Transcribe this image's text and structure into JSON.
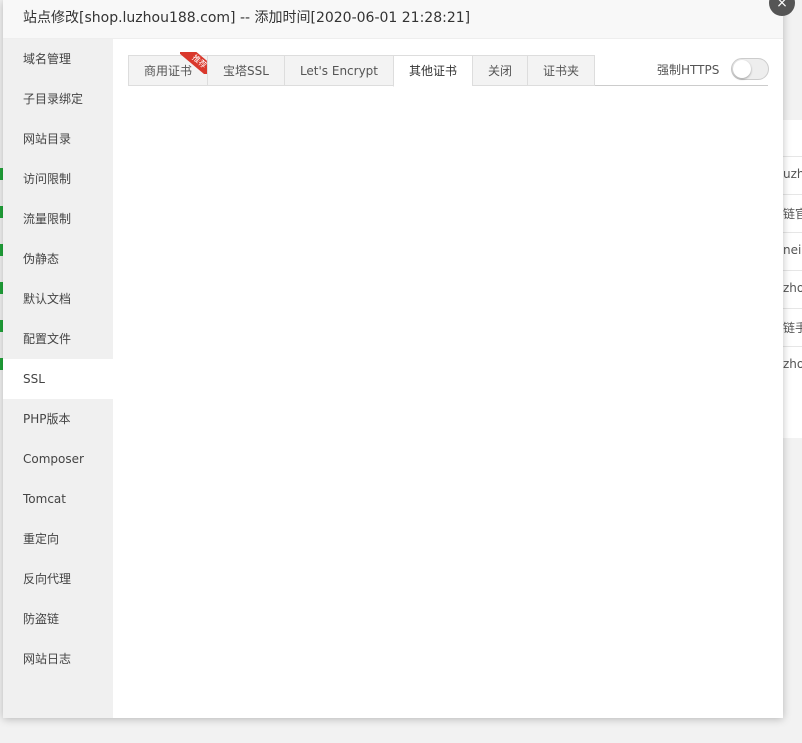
{
  "modal": {
    "title": "站点修改[shop.luzhou188.com] -- 添加时间[2020-06-01 21:28:21]",
    "close_icon": "×"
  },
  "sidebar": {
    "items": [
      {
        "label": "域名管理"
      },
      {
        "label": "子目录绑定"
      },
      {
        "label": "网站目录"
      },
      {
        "label": "访问限制"
      },
      {
        "label": "流量限制"
      },
      {
        "label": "伪静态"
      },
      {
        "label": "默认文档"
      },
      {
        "label": "配置文件"
      },
      {
        "label": "SSL"
      },
      {
        "label": "PHP版本"
      },
      {
        "label": "Composer"
      },
      {
        "label": "Tomcat"
      },
      {
        "label": "重定向"
      },
      {
        "label": "反向代理"
      },
      {
        "label": "防盗链"
      },
      {
        "label": "网站日志"
      }
    ],
    "active": "SSL"
  },
  "tabs": [
    {
      "label": "商用证书",
      "badge": "推荐"
    },
    {
      "label": "宝塔SSL"
    },
    {
      "label": "Let's Encrypt"
    },
    {
      "label": "其他证书"
    },
    {
      "label": "关闭"
    },
    {
      "label": "证书夹"
    }
  ],
  "active_tab": "其他证书",
  "force_https": {
    "label": "强制HTTPS",
    "enabled": false
  },
  "background_rows": [
    "uzho",
    "链官",
    "neil",
    "zho",
    "链手",
    "zho"
  ],
  "colors": {
    "badge": "#d9382c",
    "accent": "#20a53a"
  }
}
